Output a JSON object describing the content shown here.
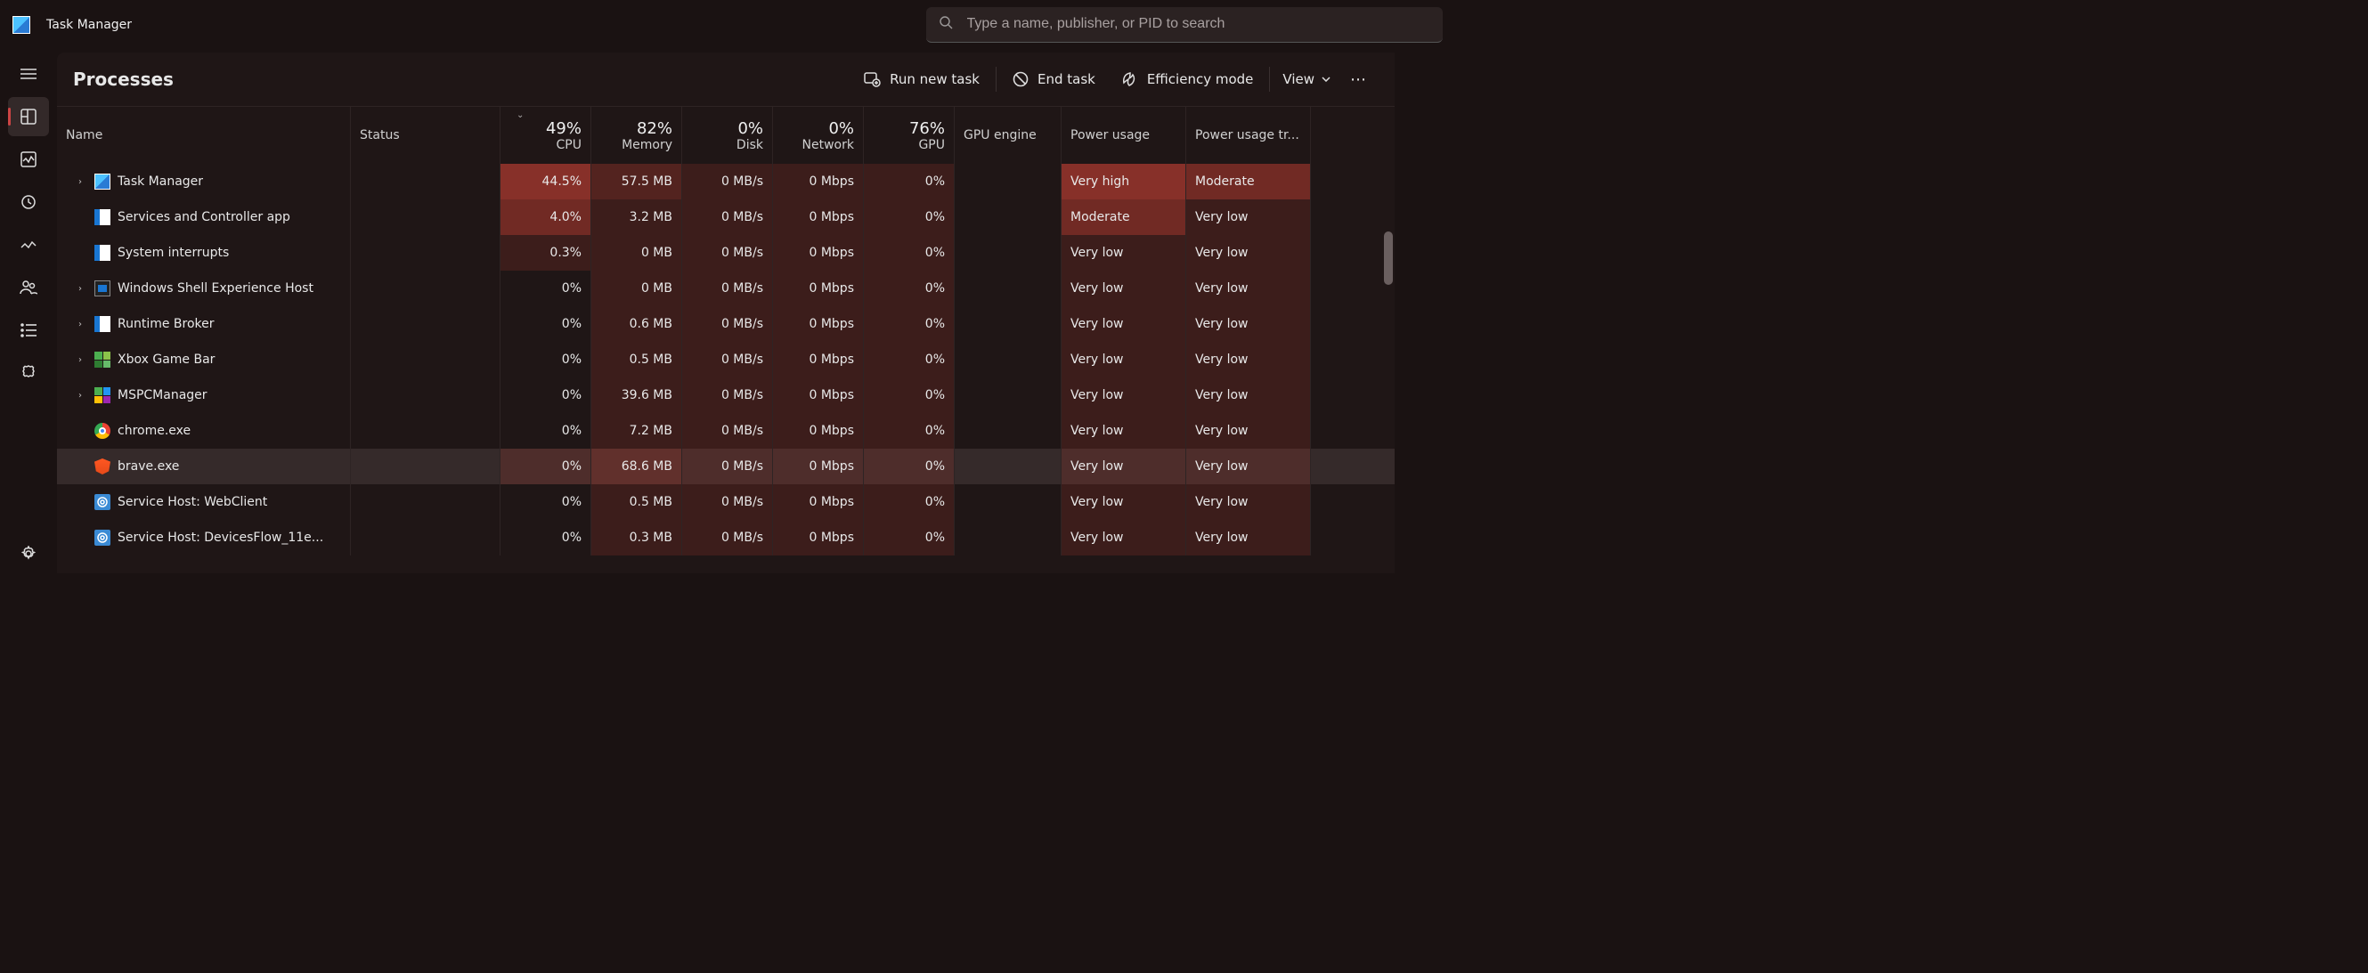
{
  "window": {
    "title": "Task Manager"
  },
  "search": {
    "placeholder": "Type a name, publisher, or PID to search"
  },
  "page": {
    "title": "Processes"
  },
  "toolbar": {
    "run_new_task": "Run new task",
    "end_task": "End task",
    "efficiency_mode": "Efficiency mode",
    "view": "View"
  },
  "columns": {
    "name": "Name",
    "status": "Status",
    "cpu": "CPU",
    "cpu_pct": "49%",
    "memory": "Memory",
    "memory_pct": "82%",
    "disk": "Disk",
    "disk_pct": "0%",
    "network": "Network",
    "network_pct": "0%",
    "gpu": "GPU",
    "gpu_pct": "76%",
    "gpu_engine": "GPU engine",
    "power_usage": "Power usage",
    "power_usage_trend": "Power usage tr..."
  },
  "rows": [
    {
      "expand": true,
      "icon": "tm",
      "name": "Task Manager",
      "cpu": "44.5%",
      "mem": "57.5 MB",
      "disk": "0 MB/s",
      "net": "0 Mbps",
      "gpu": "0%",
      "gpue": "",
      "pu": "Very high",
      "put": "Moderate",
      "cpu_heat": "heat-4",
      "mem_heat": "heat-2",
      "pu_heat": "heat-4",
      "put_heat": "heat-3"
    },
    {
      "expand": false,
      "icon": "svc",
      "name": "Services and Controller app",
      "cpu": "4.0%",
      "mem": "3.2 MB",
      "disk": "0 MB/s",
      "net": "0 Mbps",
      "gpu": "0%",
      "gpue": "",
      "pu": "Moderate",
      "put": "Very low",
      "cpu_heat": "heat-3",
      "mem_heat": "heat-1",
      "pu_heat": "heat-3",
      "put_heat": "heat-1"
    },
    {
      "expand": false,
      "icon": "svc",
      "name": "System interrupts",
      "cpu": "0.3%",
      "mem": "0 MB",
      "disk": "0 MB/s",
      "net": "0 Mbps",
      "gpu": "0%",
      "gpue": "",
      "pu": "Very low",
      "put": "Very low",
      "cpu_heat": "heat-1",
      "mem_heat": "heat-1",
      "pu_heat": "heat-1",
      "put_heat": "heat-1"
    },
    {
      "expand": true,
      "icon": "win",
      "name": "Windows Shell Experience Host",
      "cpu": "0%",
      "mem": "0 MB",
      "disk": "0 MB/s",
      "net": "0 Mbps",
      "gpu": "0%",
      "gpue": "",
      "pu": "Very low",
      "put": "Very low",
      "cpu_heat": "",
      "mem_heat": "heat-1",
      "pu_heat": "heat-1",
      "put_heat": "heat-1"
    },
    {
      "expand": true,
      "icon": "svc",
      "name": "Runtime Broker",
      "cpu": "0%",
      "mem": "0.6 MB",
      "disk": "0 MB/s",
      "net": "0 Mbps",
      "gpu": "0%",
      "gpue": "",
      "pu": "Very low",
      "put": "Very low",
      "cpu_heat": "",
      "mem_heat": "heat-1",
      "pu_heat": "heat-1",
      "put_heat": "heat-1"
    },
    {
      "expand": true,
      "icon": "xbox",
      "name": "Xbox Game Bar",
      "cpu": "0%",
      "mem": "0.5 MB",
      "disk": "0 MB/s",
      "net": "0 Mbps",
      "gpu": "0%",
      "gpue": "",
      "pu": "Very low",
      "put": "Very low",
      "cpu_heat": "",
      "mem_heat": "heat-1",
      "pu_heat": "heat-1",
      "put_heat": "heat-1"
    },
    {
      "expand": true,
      "icon": "mspc",
      "name": "MSPCManager",
      "cpu": "0%",
      "mem": "39.6 MB",
      "disk": "0 MB/s",
      "net": "0 Mbps",
      "gpu": "0%",
      "gpue": "",
      "pu": "Very low",
      "put": "Very low",
      "cpu_heat": "",
      "mem_heat": "heat-1",
      "pu_heat": "heat-1",
      "put_heat": "heat-1"
    },
    {
      "expand": false,
      "icon": "chrome",
      "name": "chrome.exe",
      "cpu": "0%",
      "mem": "7.2 MB",
      "disk": "0 MB/s",
      "net": "0 Mbps",
      "gpu": "0%",
      "gpue": "",
      "pu": "Very low",
      "put": "Very low",
      "cpu_heat": "",
      "mem_heat": "heat-1",
      "pu_heat": "heat-1",
      "put_heat": "heat-1"
    },
    {
      "expand": false,
      "icon": "brave",
      "name": "brave.exe",
      "cpu": "0%",
      "mem": "68.6 MB",
      "disk": "0 MB/s",
      "net": "0 Mbps",
      "gpu": "0%",
      "gpue": "",
      "pu": "Very low",
      "put": "Very low",
      "cpu_heat": "heat-1",
      "mem_heat": "heat-2",
      "pu_heat": "heat-1",
      "put_heat": "heat-1",
      "selected": true
    },
    {
      "expand": false,
      "icon": "gear",
      "name": "Service Host: WebClient",
      "cpu": "0%",
      "mem": "0.5 MB",
      "disk": "0 MB/s",
      "net": "0 Mbps",
      "gpu": "0%",
      "gpue": "",
      "pu": "Very low",
      "put": "Very low",
      "cpu_heat": "",
      "mem_heat": "heat-1",
      "pu_heat": "heat-1",
      "put_heat": "heat-1"
    },
    {
      "expand": false,
      "icon": "gear",
      "name": "Service Host: DevicesFlow_11e...",
      "cpu": "0%",
      "mem": "0.3 MB",
      "disk": "0 MB/s",
      "net": "0 Mbps",
      "gpu": "0%",
      "gpue": "",
      "pu": "Very low",
      "put": "Very low",
      "cpu_heat": "",
      "mem_heat": "heat-1",
      "pu_heat": "heat-1",
      "put_heat": "heat-1"
    }
  ]
}
